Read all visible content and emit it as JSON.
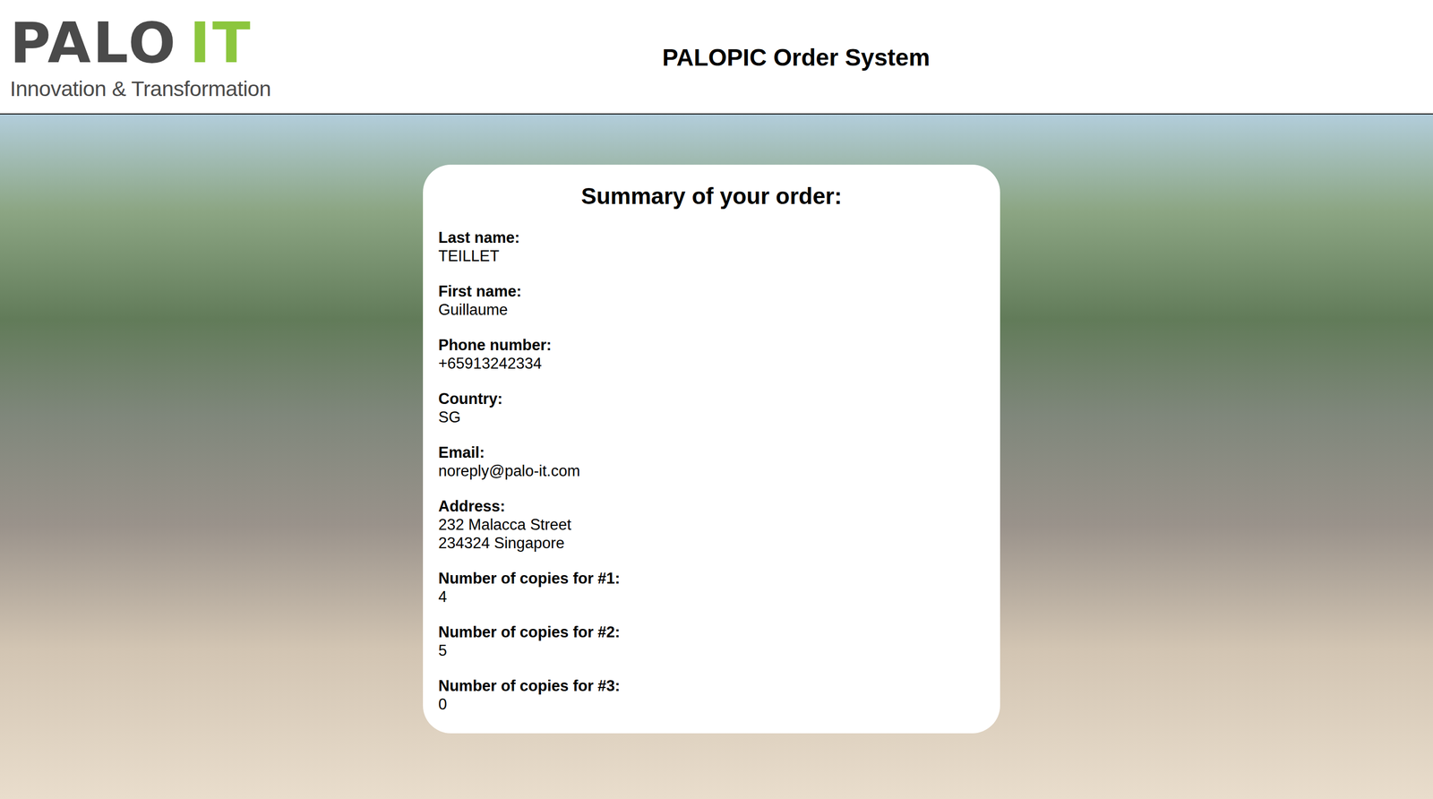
{
  "header": {
    "logo": {
      "brand": "PALO",
      "accent": "IT",
      "tagline": "Innovation & Transformation"
    },
    "title": "PALOPIC Order System"
  },
  "summary": {
    "title": "Summary of your order:",
    "fields": [
      {
        "label": "Last name:",
        "lines": [
          "TEILLET"
        ]
      },
      {
        "label": "First name:",
        "lines": [
          "Guillaume"
        ]
      },
      {
        "label": "Phone number:",
        "lines": [
          "+65913242334"
        ]
      },
      {
        "label": "Country:",
        "lines": [
          "SG"
        ]
      },
      {
        "label": "Email:",
        "lines": [
          "noreply@palo-it.com"
        ]
      },
      {
        "label": "Address:",
        "lines": [
          "232 Malacca Street",
          "234324 Singapore"
        ]
      },
      {
        "label": "Number of copies for #1:",
        "lines": [
          "4"
        ]
      },
      {
        "label": "Number of copies for #2:",
        "lines": [
          "5"
        ]
      },
      {
        "label": "Number of copies for #3:",
        "lines": [
          "0"
        ]
      }
    ]
  }
}
